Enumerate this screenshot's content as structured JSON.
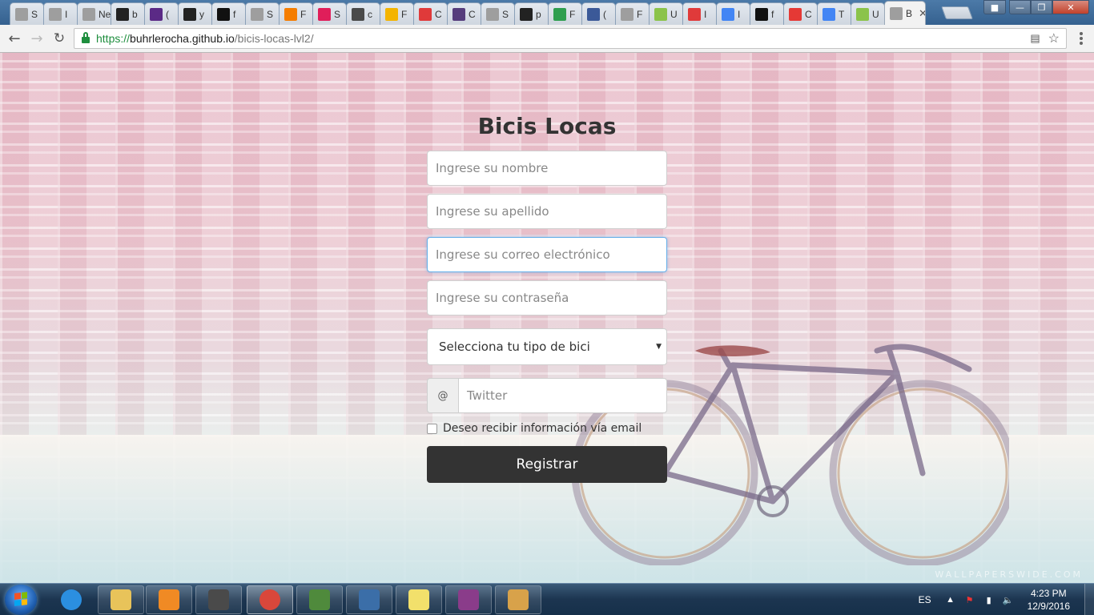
{
  "browser": {
    "tabs": [
      {
        "title": "S",
        "icon": "page-icon",
        "color": "#9e9e9e"
      },
      {
        "title": "I",
        "icon": "page-icon",
        "color": "#9e9e9e"
      },
      {
        "title": "New",
        "icon": "page-icon",
        "color": "#9e9e9e"
      },
      {
        "title": "b",
        "icon": "github-icon",
        "color": "#222222"
      },
      {
        "title": "(",
        "icon": "mail-icon",
        "color": "#5b2a86"
      },
      {
        "title": "y",
        "icon": "github-icon",
        "color": "#222222"
      },
      {
        "title": "f",
        "icon": "flag-icon",
        "color": "#111111"
      },
      {
        "title": "S",
        "icon": "page-icon",
        "color": "#9e9e9e"
      },
      {
        "title": "F",
        "icon": "blogger-icon",
        "color": "#f57d00"
      },
      {
        "title": "S",
        "icon": "slack-icon",
        "color": "#e01e5a"
      },
      {
        "title": "c",
        "icon": "hash-icon",
        "color": "#4a4a4a"
      },
      {
        "title": "F",
        "icon": "note-icon",
        "color": "#f4b400"
      },
      {
        "title": "C",
        "icon": "m-icon",
        "color": "#e03a3a"
      },
      {
        "title": "C",
        "icon": "bootstrap-icon",
        "color": "#563d7c"
      },
      {
        "title": "S",
        "icon": "page-icon",
        "color": "#9e9e9e"
      },
      {
        "title": "p",
        "icon": "github-icon",
        "color": "#222222"
      },
      {
        "title": "F",
        "icon": "px-icon",
        "color": "#2e9e4f"
      },
      {
        "title": "(",
        "icon": "facebook-icon",
        "color": "#3b5998"
      },
      {
        "title": "F",
        "icon": "page-icon",
        "color": "#9e9e9e"
      },
      {
        "title": "U",
        "icon": "e-icon",
        "color": "#8bc34a"
      },
      {
        "title": "I",
        "icon": "m-icon",
        "color": "#e03a3a"
      },
      {
        "title": "I",
        "icon": "google-icon",
        "color": "#4285f4"
      },
      {
        "title": "f",
        "icon": "flag-icon",
        "color": "#111111"
      },
      {
        "title": "C",
        "icon": "f-icon",
        "color": "#e53935"
      },
      {
        "title": "T",
        "icon": "translate-icon",
        "color": "#4285f4"
      },
      {
        "title": "U",
        "icon": "e-icon",
        "color": "#8bc34a"
      },
      {
        "title": "B",
        "icon": "page-icon",
        "color": "#9e9e9e",
        "active": true
      }
    ],
    "address": {
      "scheme": "https://",
      "host": "buhrlerocha.github.io",
      "path": "/bicis-locas-lvl2/"
    }
  },
  "page": {
    "title": "Bicis Locas",
    "name_placeholder": "Ingrese su nombre",
    "lastname_placeholder": "Ingrese su apellido",
    "email_placeholder": "Ingrese su correo electrónico",
    "password_placeholder": "Ingrese su contraseña",
    "bike_select": "Selecciona tu tipo de bici",
    "twitter_addon": "@",
    "twitter_placeholder": "Twitter",
    "checkbox_label": "Deseo recibir información vía email",
    "submit_label": "Registrar",
    "watermark": "WALLPAPERSWIDE.COM"
  },
  "taskbar": {
    "apps": [
      "ie-icon",
      "explorer-icon",
      "media-player-icon",
      "sublime-text-icon",
      "chrome-icon",
      "git-icon",
      "git-gui-icon",
      "sticky-notes-icon",
      "winrar-icon",
      "paint-icon"
    ],
    "language": "ES",
    "time": "4:23 PM",
    "date": "12/9/2016"
  }
}
